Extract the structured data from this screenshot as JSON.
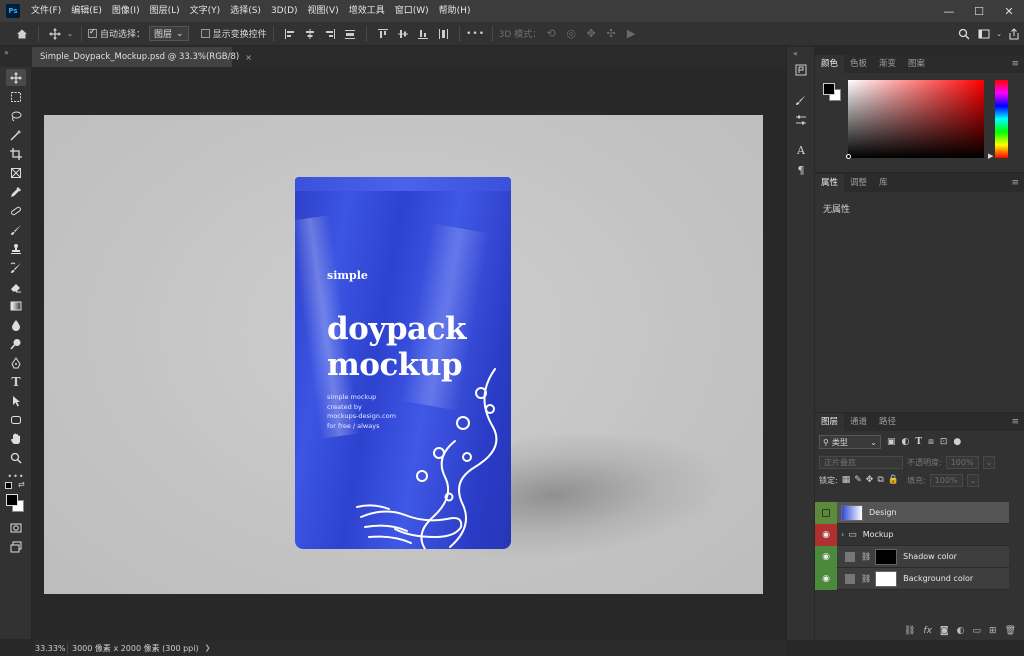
{
  "app": {
    "logo": "Ps"
  },
  "menu": [
    "文件(F)",
    "编辑(E)",
    "图像(I)",
    "图层(L)",
    "文字(Y)",
    "选择(S)",
    "3D(D)",
    "视图(V)",
    "增效工具",
    "窗口(W)",
    "帮助(H)"
  ],
  "window_controls": {
    "minimize": "—",
    "maximize": "☐",
    "close": "✕"
  },
  "options": {
    "auto_select_label": "自动选择：",
    "auto_select_checked": true,
    "target_value": "图层",
    "show_transform_label": "显示变换控件",
    "show_transform_checked": false,
    "more": "•••",
    "mode_3d_label": "3D 模式："
  },
  "document": {
    "tab_title": "Simple_Doypack_Mockup.psd @ 33.3%(RGB/8)",
    "tab_close": "×"
  },
  "pouch": {
    "small_word": "simple",
    "title_line1": "doypack",
    "title_line2": "mockup",
    "body_lines": [
      "simple mockup",
      "created by",
      "mockups-design.com",
      "for free / always"
    ]
  },
  "tools": [
    "move-icon",
    "marquee-icon",
    "lasso-icon",
    "magic-wand-icon",
    "crop-icon",
    "frame-icon",
    "eyedropper-icon",
    "healing-icon",
    "brush-icon",
    "stamp-icon",
    "history-brush-icon",
    "eraser-icon",
    "gradient-icon",
    "blur-icon",
    "dodge-icon",
    "pen-icon",
    "type-icon",
    "path-select-icon",
    "shape-icon",
    "hand-icon",
    "zoom-icon",
    "more-tools-icon"
  ],
  "tool_glyphs": {
    "type": "T",
    "more": "•••"
  },
  "panels": {
    "color_tabs": [
      "颜色",
      "色板",
      "渐变",
      "图案"
    ],
    "props_tabs": [
      "属性",
      "调整",
      "库"
    ],
    "props_text": "无属性",
    "layers_tabs": [
      "图层",
      "通道",
      "路径"
    ],
    "layers_search": "类型",
    "blend_mode": "正片叠底",
    "opacity_label": "不透明度:",
    "opacity_value": "100%",
    "lock_label": "锁定:",
    "fill_label": "填充:",
    "fill_value": "100%",
    "menu_glyph": "≡"
  },
  "layers": [
    {
      "name": "Design",
      "eye": "",
      "eye_color": "#5a8a3a",
      "selected": true
    },
    {
      "name": "Mockup",
      "eye": "👁",
      "eye_color": "#b03030",
      "selected": false,
      "group": true
    },
    {
      "name": "Shadow color",
      "eye": "👁",
      "eye_color": "#4a8a3a",
      "selected": false
    },
    {
      "name": "Background color",
      "eye": "👁",
      "eye_color": "#4a8a3a",
      "selected": false
    }
  ],
  "status": {
    "zoom": "33.33%",
    "doc_info": "3000 像素 x 2000 像素 (300 ppi)",
    "arrow": "❯"
  },
  "colors": {
    "pouch_blue": "#3049d6",
    "canvas_bg": "#c5c5c5",
    "workspace": "#282828"
  }
}
